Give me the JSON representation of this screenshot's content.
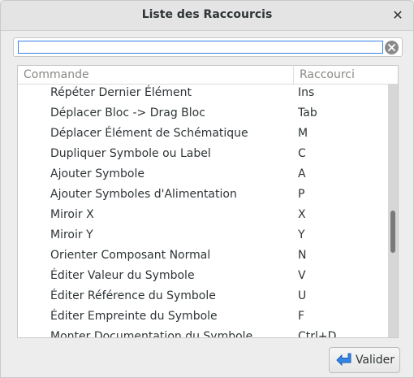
{
  "window": {
    "title": "Liste des Raccourcis"
  },
  "search": {
    "value": "",
    "placeholder": ""
  },
  "table": {
    "columns": [
      "Commande",
      "Raccourci"
    ],
    "rows": [
      {
        "command": "Répéter Dernier Élément",
        "shortcut": "Ins"
      },
      {
        "command": "Déplacer Bloc -> Drag Bloc",
        "shortcut": "Tab"
      },
      {
        "command": "Déplacer Élément de Schématique",
        "shortcut": "M"
      },
      {
        "command": "Dupliquer Symbole ou Label",
        "shortcut": "C"
      },
      {
        "command": "Ajouter Symbole",
        "shortcut": "A"
      },
      {
        "command": "Ajouter Symboles d'Alimentation",
        "shortcut": "P"
      },
      {
        "command": "Miroir X",
        "shortcut": "X"
      },
      {
        "command": "Miroir Y",
        "shortcut": "Y"
      },
      {
        "command": "Orienter Composant Normal",
        "shortcut": "N"
      },
      {
        "command": "Éditer Valeur du Symbole",
        "shortcut": "V"
      },
      {
        "command": "Éditer Référence du Symbole",
        "shortcut": "U"
      },
      {
        "command": "Éditer Empreinte du Symbole",
        "shortcut": "F"
      },
      {
        "command": "Monter Documentation du Symbole",
        "shortcut": "Ctrl+D"
      }
    ]
  },
  "buttons": {
    "ok_label": "Valider"
  },
  "colors": {
    "accent": "#3584e4",
    "title_bar": "#e4e4e4",
    "background": "#ededed"
  },
  "icons": {
    "close": "close-icon",
    "clear": "clear-search-icon",
    "ok": "arrow-left-icon"
  }
}
